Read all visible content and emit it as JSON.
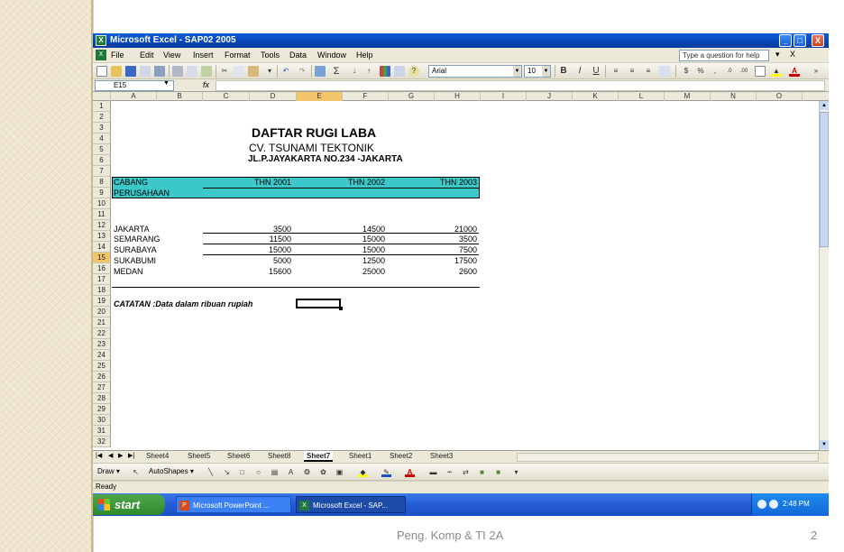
{
  "slide": {
    "footer": "Peng. Komp & TI 2A",
    "page_number": "2"
  },
  "window": {
    "title": "Microsoft Excel - SAP02 2005",
    "controls": [
      "_",
      "□",
      "X"
    ]
  },
  "menu": {
    "items": [
      "File",
      "Edit",
      "View",
      "Insert",
      "Format",
      "Tools",
      "Data",
      "Window",
      "Help"
    ],
    "help_placeholder": "Type a question for help",
    "close": "X"
  },
  "toolbar": {
    "font": "Arial",
    "size": "10",
    "bold": "B",
    "italic": "I",
    "underline": "U",
    "autosum": "Σ",
    "currency": "$",
    "percent": "%",
    "comma": ","
  },
  "formula_bar": {
    "name_box": "E15",
    "fx": "fx",
    "value": ""
  },
  "columns": [
    "A",
    "B",
    "C",
    "D",
    "E",
    "F",
    "G",
    "H",
    "I",
    "J",
    "K",
    "L",
    "M",
    "N",
    "O"
  ],
  "active_column": "E",
  "rows": [
    "1",
    "2",
    "3",
    "4",
    "5",
    "6",
    "7",
    "8",
    "9",
    "10",
    "11",
    "12",
    "13",
    "14",
    "15",
    "16",
    "17",
    "18",
    "19",
    "20",
    "21",
    "22",
    "23",
    "24",
    "25",
    "26",
    "27",
    "28",
    "29",
    "30",
    "31",
    "32"
  ],
  "active_row": "15",
  "sheet": {
    "title": "DAFTAR RUGI LABA",
    "company": "CV. TSUNAMI TEKTONIK",
    "address": "JL.P.JAYAKARTA NO.234 -JAKARTA",
    "header_col1_line1": "CABANG",
    "header_col1_line2": "PERUSAHAAN",
    "header_years": [
      "THN 2001",
      "THN 2002",
      "THN 2003"
    ],
    "data_rows": [
      {
        "branch": "JAKARTA",
        "values": [
          "3500",
          "14500",
          "21000"
        ]
      },
      {
        "branch": "SEMARANG",
        "values": [
          "11500",
          "15000",
          "3500"
        ]
      },
      {
        "branch": "SURABAYA",
        "values": [
          "15000",
          "15000",
          "7500"
        ]
      },
      {
        "branch": "SUKABUMI",
        "values": [
          "5000",
          "12500",
          "17500"
        ]
      },
      {
        "branch": "MEDAN",
        "values": [
          "15600",
          "25000",
          "2600"
        ]
      }
    ],
    "note": "CATATAN :Data dalam ribuan rupiah"
  },
  "tabs": {
    "items": [
      "Sheet4",
      "Sheet5",
      "Sheet6",
      "Sheet8",
      "Sheet7",
      "Sheet1",
      "Sheet2",
      "Sheet3"
    ],
    "active": "Sheet7"
  },
  "drawing": {
    "draw_label": "Draw ▾",
    "autoshapes_label": "AutoShapes ▾"
  },
  "status": {
    "text": "Ready"
  },
  "taskbar": {
    "start": "start",
    "tasks": [
      "Microsoft PowerPoint ...",
      "Microsoft Excel - SAP..."
    ],
    "clock": "2:48 PM"
  },
  "colors": {
    "header_band": "#3cc8c8",
    "active_header": "#f3c56b",
    "titlebar": "#0a5fd8"
  }
}
